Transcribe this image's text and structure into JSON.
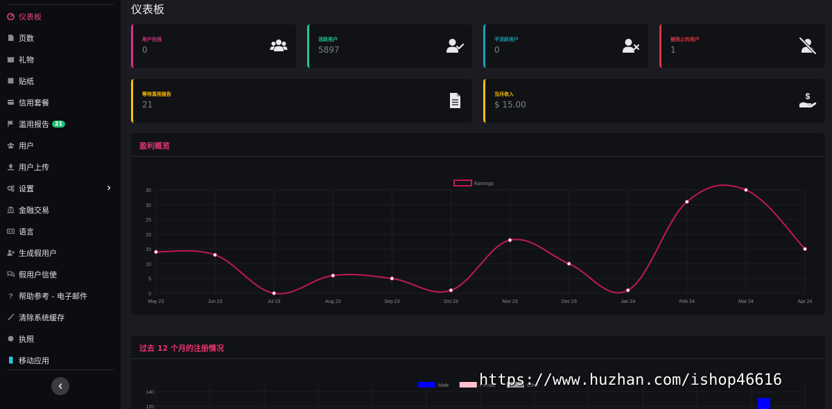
{
  "sidebar": {
    "items": [
      {
        "label": "仪表板",
        "icon": "dashboard-icon",
        "active": true
      },
      {
        "label": "页数",
        "icon": "page-icon"
      },
      {
        "label": "礼物",
        "icon": "gift-icon"
      },
      {
        "label": "贴纸",
        "icon": "sticker-icon"
      },
      {
        "label": "信用套餐",
        "icon": "package-icon"
      },
      {
        "label": "滥用报告",
        "icon": "flag-icon",
        "badge": "21"
      },
      {
        "label": "用户",
        "icon": "users-icon"
      },
      {
        "label": "用户上传",
        "icon": "upload-icon"
      },
      {
        "label": "设置",
        "icon": "gears-icon",
        "has_submenu": true
      },
      {
        "label": "金融交易",
        "icon": "bank-icon"
      },
      {
        "label": "语言",
        "icon": "language-icon"
      },
      {
        "label": "生成假用户",
        "icon": "user-plus-icon"
      },
      {
        "label": "假用户信使",
        "icon": "messenger-icon"
      },
      {
        "label": "帮助参考 - 电子邮件",
        "icon": "question-icon"
      },
      {
        "label": "清除系统缓存",
        "icon": "broom-icon"
      },
      {
        "label": "执照",
        "icon": "circle-icon"
      },
      {
        "label": "移动应用",
        "icon": "mobile-icon"
      }
    ]
  },
  "page": {
    "title": "仪表板"
  },
  "cards": [
    {
      "label": "用户在线",
      "value": "0",
      "color": "#d63384",
      "icon": "users-icon"
    },
    {
      "label": "活跃用户",
      "value": "5897",
      "color": "#20c997",
      "icon": "user-check-icon"
    },
    {
      "label": "不活跃用户",
      "value": "0",
      "color": "#17a2b8",
      "icon": "user-times-icon"
    },
    {
      "label": "被阻止的用户",
      "value": "1",
      "color": "#dc3545",
      "icon": "user-slash-icon"
    },
    {
      "label": "等待滥用报告",
      "value": "21",
      "color": "#ffc107",
      "icon": "document-icon"
    },
    {
      "label": "当月收入",
      "value": "$ 15.00",
      "color": "#ffc107",
      "icon": "hand-dollar-icon"
    }
  ],
  "earnings_panel": {
    "title": "盈利概览"
  },
  "registrations_panel": {
    "title": "过去 12 个月的注册情况"
  },
  "chart_data": [
    {
      "type": "line",
      "categories": [
        "May 23",
        "Jun 23",
        "Jul 23",
        "Aug 23",
        "Sep 23",
        "Oct 23",
        "Nov 23",
        "Dec 23",
        "Jan 24",
        "Feb 24",
        "Mar 24",
        "Apr 24"
      ],
      "series": [
        {
          "name": "Earnings",
          "values": [
            14,
            13,
            0,
            6,
            5,
            1,
            18,
            10,
            1,
            31,
            35,
            15
          ],
          "color": "#c2185b"
        }
      ],
      "yticks": [
        "0",
        "5",
        "10",
        "15",
        "20",
        "25",
        "30",
        "35"
      ],
      "ylim": [
        0,
        35
      ],
      "legend": "top-center",
      "grid": true
    },
    {
      "type": "bar",
      "series": [
        {
          "name": "Male",
          "color": "#0000ff"
        },
        {
          "name": "Female",
          "color": "#ffc0cb"
        },
        {
          "name": "Other",
          "color": "#a0a0a0"
        }
      ],
      "yticks": [
        "140",
        "120"
      ],
      "legend": "top-center"
    }
  ],
  "watermark": "https://www.huzhan.com/ishop46616"
}
